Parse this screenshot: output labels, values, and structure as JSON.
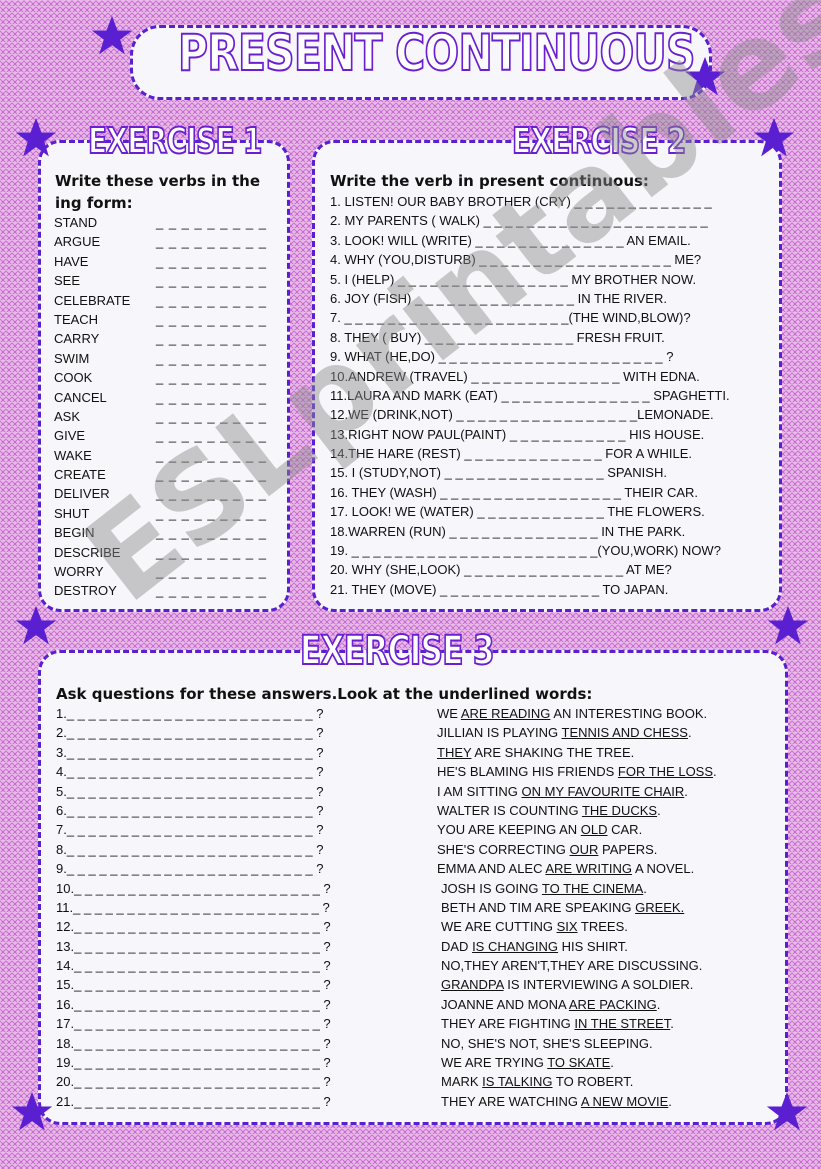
{
  "worksheet": {
    "title": "PRESENT CONTINUOUS",
    "accent_color": "#5a1fd0",
    "background_color": "#e8b8e8",
    "watermark": "ESLprintables.com"
  },
  "exercise1": {
    "heading": "EXERCISE 1",
    "instruction": "Write these verbs in the ing form:",
    "blank": "_ _ _ _ _ _ _ _ _",
    "verbs": [
      "STAND",
      "ARGUE",
      "HAVE",
      "SEE",
      "CELEBRATE",
      "TEACH",
      "CARRY",
      "SWIM",
      "COOK",
      "CANCEL",
      "ASK",
      "GIVE",
      "WAKE",
      "CREATE",
      "DELIVER",
      "SHUT",
      "BEGIN",
      "DESCRIBE",
      "WORRY",
      "DESTROY"
    ]
  },
  "exercise2": {
    "heading": "EXERCISE 2",
    "instruction": "Write the verb in present continuous:",
    "items": [
      "1. LISTEN! OUR BABY BROTHER (CRY) _ _ _ _ _ _ _ _ _ _ _ _ _",
      "2. MY PARENTS ( WALK) _ _ _ _ _ _ _ _ _ _ _ _ _ _ _ _ _ _ _ _ _",
      "3. LOOK! WILL (WRITE)  _ _ _ _ _ _ _ _ _ _ _ _ _ _ AN EMAIL.",
      "4. WHY (YOU,DISTURB) _ _ _ _ _ _ _ _ _ _ _ _ _ _ _ _ _ _ ME?",
      "5. I (HELP) _ _ _ _ _ _ _ _ _ _ _ _ _ _ _ _ MY BROTHER NOW.",
      "6. JOY (FISH) _ _ _ _ _ _ _ _ _ _ _ _ _ _ _ IN THE RIVER.",
      "7.  _ _ _ _ _ _ _ _ _ _ _ _ _ _ _ _ _ _ _ _ _(THE WIND,BLOW)?",
      "8. THEY ( BUY) _ _ _ _ _ _ _ _ _ _ _ _ _ _ FRESH FRUIT.",
      "9. WHAT (HE,DO) _ _ _ _ _ _ _ _ _ _ _ _ _ _ _ _ _ _ _ _ _ ?",
      "10.ANDREW (TRAVEL)  _ _ _ _ _ _ _ _ _ _ _ _ _ _ WITH EDNA.",
      "11.LAURA AND MARK (EAT) _ _ _ _ _ _ _ _ _ _ _ _ _ _ SPAGHETTI.",
      "12.WE (DRINK,NOT) _ _ _ _ _ _ _ _ _ _ _ _ _ _ _ _ _LEMONADE.",
      "13.RIGHT NOW PAUL(PAINT) _ _ _ _ _ _ _ _ _ _ _ HIS HOUSE.",
      "14.THE HARE (REST) _ _ _ _ _ _ _ _ _ _ _ _ _ FOR A WHILE.",
      "15. I (STUDY,NOT)  _ _ _ _ _ _ _ _ _ _ _ _ _ _ _ SPANISH.",
      "16. THEY (WASH) _ _ _ _ _ _ _ _ _ _ _ _ _ _ _ _ _ THEIR CAR.",
      "17. LOOK! WE (WATER)  _ _ _ _ _ _ _ _ _ _ _ _ THE FLOWERS.",
      "18.WARREN (RUN) _ _ _ _ _ _ _ _ _ _ _ _ _ _ IN THE PARK.",
      "19. _ _ _ _ _ _ _ _ _ _ _ _ _ _ _ _ _ _ _ _ _ _ _(YOU,WORK) NOW?",
      "20. WHY (SHE,LOOK) _ _ _ _ _ _ _ _ _ _ _ _ _ _ _ AT ME?",
      "21. THEY (MOVE)  _ _ _ _ _ _ _ _ _ _ _ _ _ _ _ TO JAPAN."
    ]
  },
  "exercise3": {
    "heading": "EXERCISE 3",
    "instruction": "Ask questions for these answers.Look at the underlined words:",
    "questions": [
      "1._ _ _ _ _ _ _ _ _ _ _ _ _ _ _ _ _ _ _ _ _ _ _ ?",
      "2._ _ _ _ _ _ _ _ _ _ _ _ _ _ _ _ _ _ _ _ _ _ _ ?",
      "3._ _ _ _ _ _ _ _ _ _ _ _ _ _ _ _ _ _ _ _ _ _ _ ?",
      "4._ _ _ _ _ _ _ _ _ _ _ _ _ _ _ _ _ _ _ _ _ _ _ ?",
      "5._ _ _ _ _ _ _ _ _ _ _ _ _ _ _ _ _ _ _ _ _ _ _ ?",
      "6._ _ _ _ _ _ _ _ _ _ _ _ _ _ _ _ _ _ _ _ _ _ _ ?",
      "7._ _ _ _ _ _ _ _ _ _ _ _ _ _ _ _ _ _ _ _ _ _ _ ?",
      "8._ _ _ _ _ _ _ _ _ _ _ _ _ _ _ _ _ _ _ _ _ _ _ ?",
      "9._ _ _ _ _ _ _ _ _ _ _ _ _ _ _ _ _ _ _ _ _ _ _ ?",
      "10._ _ _ _ _ _ _ _ _ _ _ _ _ _ _ _ _ _ _ _ _ _ _ ?",
      "11._ _ _ _ _ _ _ _ _ _ _ _ _ _ _ _ _ _ _ _ _ _ _ ?",
      "12._ _ _ _ _ _ _ _ _ _ _ _ _ _ _ _ _ _ _ _ _ _ _ ?",
      "13._ _ _ _ _ _ _ _ _ _ _ _ _ _ _ _ _ _ _ _ _ _ _ ?",
      "14._ _ _ _ _ _ _ _ _ _ _ _ _ _ _ _ _ _ _ _ _ _ _ ?",
      "15._ _ _ _ _ _ _ _ _ _ _ _ _ _ _ _ _ _ _ _ _ _ _ ?",
      "16._ _ _ _ _ _ _ _ _ _ _ _ _ _ _ _ _ _ _ _ _ _ _ ?",
      "17._ _ _ _ _ _ _ _ _ _ _ _ _ _ _ _ _ _ _ _ _ _ _ ?",
      "18._ _ _ _ _ _ _ _ _ _ _ _ _ _ _ _ _ _ _ _ _ _ _ ?",
      "19._ _ _ _ _ _ _ _ _ _ _ _ _ _ _ _ _ _ _ _ _ _ _ ?",
      "20._ _ _ _ _ _ _ _ _ _ _ _ _ _ _ _ _ _ _ _ _ _ _ ?",
      "21._ _ _ _ _ _ _ _ _ _ _ _ _ _ _ _ _ _ _ _ _ _ _ ?"
    ],
    "answers": [
      {
        "before": "WE ",
        "underlined": "ARE READING",
        "after": " AN INTERESTING BOOK."
      },
      {
        "before": "JILLIAN IS PLAYING ",
        "underlined": "TENNIS AND CHESS",
        "after": "."
      },
      {
        "before": "",
        "underlined": "THEY",
        "after": " ARE SHAKING THE TREE."
      },
      {
        "before": "HE'S BLAMING HIS FRIENDS ",
        "underlined": "FOR THE LOSS",
        "after": "."
      },
      {
        "before": "I AM SITTING ",
        "underlined": "ON MY FAVOURITE CHAIR",
        "after": "."
      },
      {
        "before": "WALTER IS COUNTING ",
        "underlined": "THE DUCKS",
        "after": "."
      },
      {
        "before": "YOU ARE KEEPING AN ",
        "underlined": "OLD",
        "after": " CAR."
      },
      {
        "before": "SHE'S CORRECTING ",
        "underlined": "OUR",
        "after": " PAPERS."
      },
      {
        "before": "EMMA AND ALEC ",
        "underlined": "ARE WRITING",
        "after": " A NOVEL."
      },
      {
        "before": "JOSH IS GOING ",
        "underlined": "TO THE CINEMA",
        "after": "."
      },
      {
        "before": "BETH AND TIM ARE SPEAKING ",
        "underlined": "GREEK.",
        "after": ""
      },
      {
        "before": "WE ARE CUTTING ",
        "underlined": "SIX",
        "after": " TREES."
      },
      {
        "before": "DAD ",
        "underlined": "IS CHANGING",
        "after": " HIS SHIRT."
      },
      {
        "before": "NO,THEY AREN'T,THEY ARE DISCUSSING.",
        "underlined": "",
        "after": ""
      },
      {
        "before": "",
        "underlined": "GRANDPA",
        "after": " IS INTERVIEWING A SOLDIER."
      },
      {
        "before": "JOANNE AND MONA ",
        "underlined": "ARE PACKING",
        "after": "."
      },
      {
        "before": "THEY ARE FIGHTING ",
        "underlined": "IN THE STREET",
        "after": "."
      },
      {
        "before": "NO, SHE'S NOT, SHE'S SLEEPING.",
        "underlined": "",
        "after": ""
      },
      {
        "before": "WE ARE TRYING ",
        "underlined": "TO SKATE",
        "after": "."
      },
      {
        "before": "MARK ",
        "underlined": "IS TALKING",
        "after": " TO ROBERT."
      },
      {
        "before": "THEY ARE WATCHING ",
        "underlined": "A NEW MOVIE",
        "after": "."
      }
    ]
  }
}
